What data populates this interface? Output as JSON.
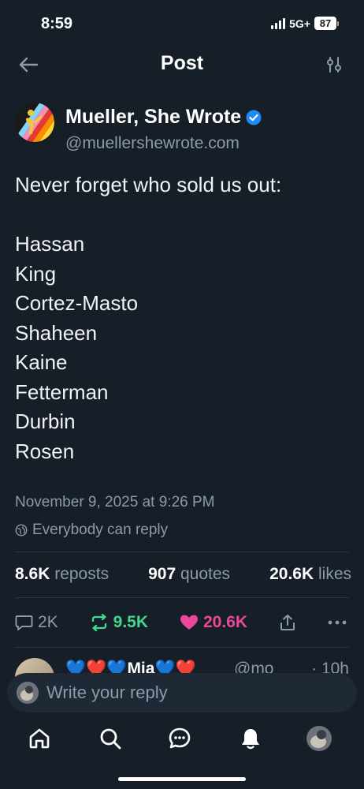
{
  "status_bar": {
    "time": "8:59",
    "network": "5G+",
    "battery": "87"
  },
  "header": {
    "title": "Post"
  },
  "post": {
    "author_name": "Mueller, She Wrote",
    "author_handle": "@muellershewrote.com",
    "text_lines": [
      "Never forget who sold us out:",
      "",
      "Hassan",
      "King",
      "Cortez-Masto",
      "Shaheen",
      "Kaine",
      "Fetterman",
      "Durbin",
      "Rosen"
    ],
    "timestamp": "November 9, 2025 at 9:26 PM",
    "reply_permission": "Everybody can reply",
    "stats": {
      "reposts_count": "8.6K",
      "reposts_label": "reposts",
      "quotes_count": "907",
      "quotes_label": "quotes",
      "likes_count": "20.6K",
      "likes_label": "likes"
    },
    "actions": {
      "replies": "2K",
      "reposts": "9.5K",
      "likes": "20.6K"
    }
  },
  "reply_preview": {
    "name": "💙❤️💙Mia💙❤️",
    "handle": "@mo",
    "time": "· 10h"
  },
  "composer": {
    "placeholder": "Write your reply"
  },
  "colors": {
    "background": "#161e27",
    "repost": "#3fd98f",
    "like": "#ec4899",
    "verified": "#1d8cf8",
    "muted": "#8c9baa"
  },
  "nav_icons": [
    "home-icon",
    "search-icon",
    "chat-icon",
    "bell-icon",
    "profile-avatar"
  ]
}
